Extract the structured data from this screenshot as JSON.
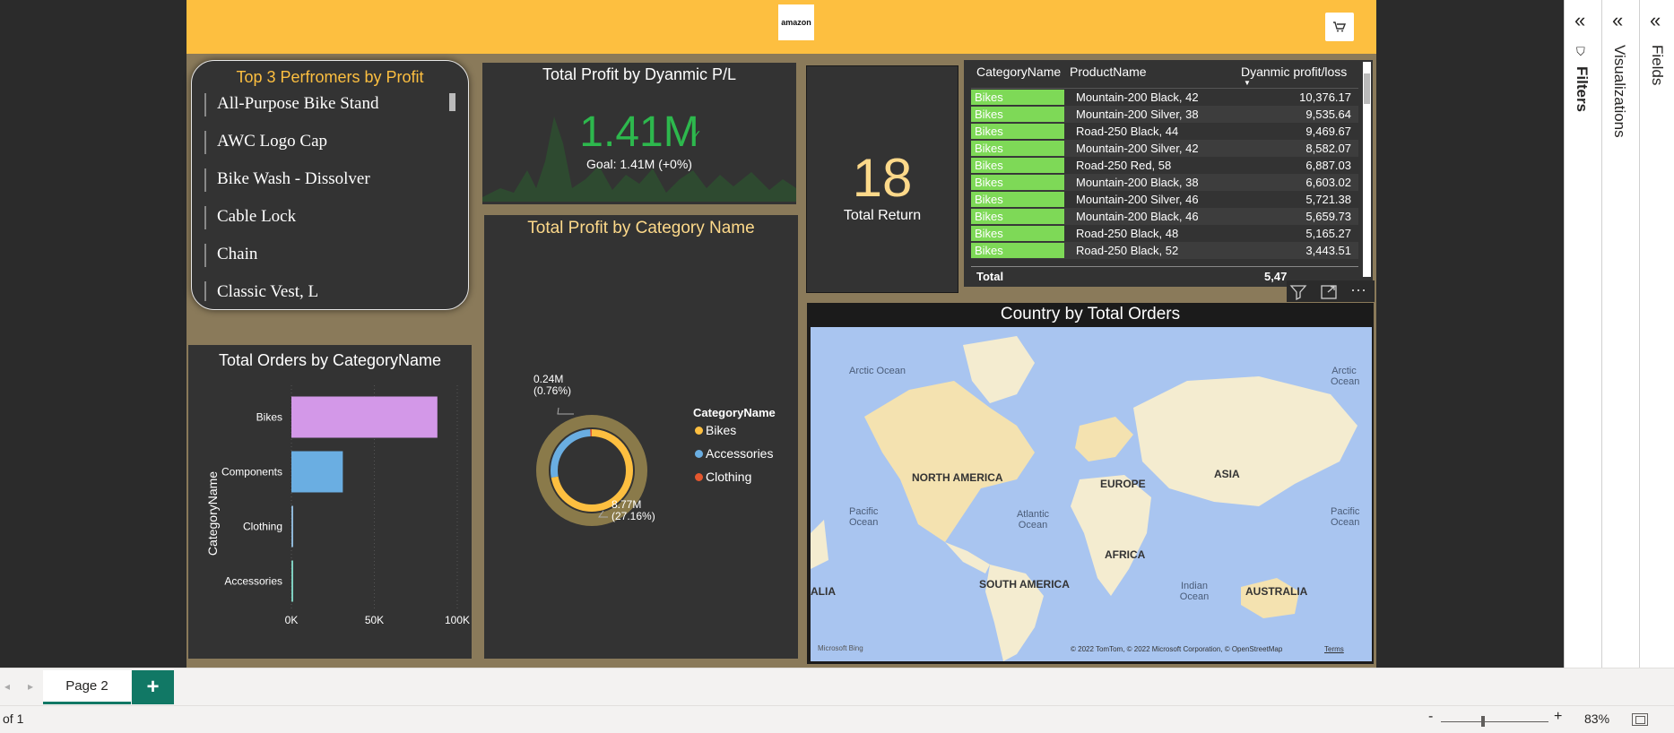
{
  "header": {
    "logo_text": "amazon",
    "cart_icon": "cart-icon"
  },
  "slicer": {
    "title": "Top 3 Perfromers by Profit",
    "items": [
      "All-Purpose Bike Stand",
      "AWC Logo Cap",
      "Bike Wash - Dissolver",
      "Cable Lock",
      "Chain",
      "Classic Vest, L"
    ]
  },
  "kpi": {
    "title": "Total Profit by Dyanmic P/L",
    "value": "1.41M",
    "goal": "Goal: 1.41M (+0%)",
    "color": "#2db84d"
  },
  "card": {
    "value": "18",
    "label": "Total Return"
  },
  "table": {
    "headers": [
      "CategoryName",
      "ProductName",
      "Dyanmic profit/loss"
    ],
    "rows": [
      {
        "cat": "Bikes",
        "prod": "Mountain-200 Black, 42",
        "val": "10,376.17"
      },
      {
        "cat": "Bikes",
        "prod": "Mountain-200 Silver, 38",
        "val": "9,535.64"
      },
      {
        "cat": "Bikes",
        "prod": "Road-250 Black, 44",
        "val": "9,469.67"
      },
      {
        "cat": "Bikes",
        "prod": "Mountain-200 Silver, 42",
        "val": "8,582.07"
      },
      {
        "cat": "Bikes",
        "prod": "Road-250 Red, 58",
        "val": "6,887.03"
      },
      {
        "cat": "Bikes",
        "prod": "Mountain-200 Black, 38",
        "val": "6,603.02"
      },
      {
        "cat": "Bikes",
        "prod": "Mountain-200 Silver, 46",
        "val": "5,721.38"
      },
      {
        "cat": "Bikes",
        "prod": "Mountain-200 Black, 46",
        "val": "5,659.73"
      },
      {
        "cat": "Bikes",
        "prod": "Road-250 Black, 48",
        "val": "5,165.27"
      },
      {
        "cat": "Bikes",
        "prod": "Road-250 Black, 52",
        "val": "3,443.51"
      }
    ],
    "total_label": "Total",
    "total_value": "5,47"
  },
  "chart_data": [
    {
      "type": "bar",
      "title": "Total Orders by CategoryName",
      "ylabel": "CategoryName",
      "xlabel": "",
      "categories": [
        "Bikes",
        "Components",
        "Clothing",
        "Accessories"
      ],
      "values": [
        88000,
        31000,
        1000,
        900
      ],
      "colors": [
        "#d398e8",
        "#6aaee2",
        "#8fb7d8",
        "#7fcfc0"
      ],
      "xlim": [
        0,
        100000
      ],
      "xticks": [
        "0K",
        "50K",
        "100K"
      ]
    },
    {
      "type": "pie",
      "title": "Total Profit by Category Name",
      "legend_title": "CategoryName",
      "categories": [
        "Bikes",
        "Accessories",
        "Clothing"
      ],
      "values": [
        72.08,
        27.16,
        0.76
      ],
      "colors": [
        "#fdbf40",
        "#6aaee2",
        "#e4572e"
      ],
      "labels": [
        {
          "text1": "0.24M",
          "text2": "(0.76%)"
        },
        {
          "text1": "8.77M",
          "text2": "(27.16%)"
        }
      ]
    }
  ],
  "map": {
    "title": "Country by Total Orders",
    "labels": [
      "Arctic Ocean",
      "Arctic Ocean",
      "NORTH AMERICA",
      "EUROPE",
      "ASIA",
      "Pacific Ocean",
      "Atlantic Ocean",
      "Pacific Ocean",
      "AFRICA",
      "SOUTH AMERICA",
      "Indian Ocean",
      "AUSTRALIA",
      "ALIA"
    ],
    "bing": "Microsoft Bing",
    "copyright": "© 2022 TomTom, © 2022 Microsoft Corporation, © OpenStreetMap",
    "terms": "Terms"
  },
  "panes": {
    "filters": "Filters",
    "visualizations": "Visualizations",
    "fields": "Fields"
  },
  "pages": {
    "tab": "Page 2",
    "add": "+"
  },
  "status": {
    "page_of": "of 1",
    "zoom": "83%",
    "minus": "-",
    "plus": "+"
  }
}
